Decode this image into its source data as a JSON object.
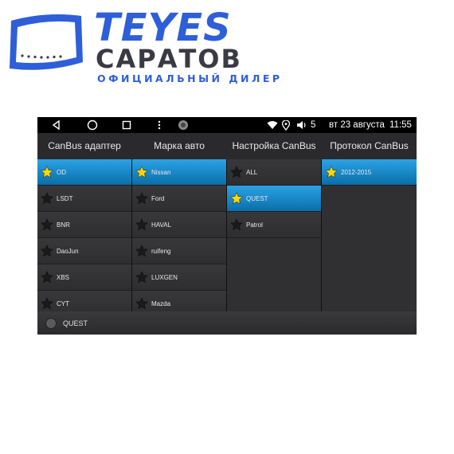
{
  "logo": {
    "brand": "TEYES",
    "city": "САРАТОВ",
    "tagline": "ОФИЦИАЛЬНЫЙ ДИЛЕР",
    "brand_color": "#2e5fd8"
  },
  "status_bar": {
    "icons": [
      "back-icon",
      "home-icon",
      "recents-icon",
      "menu-dots-icon",
      "app-icon",
      "wifi-icon",
      "location-icon",
      "volume-icon"
    ],
    "volume_level": "5",
    "date": "вт 23 августа",
    "time": "11:55"
  },
  "columns": [
    {
      "header": "CanBus адаптер",
      "selected_index": 0,
      "items": [
        "OD",
        "LSDT",
        "BNR",
        "DaoJun",
        "XBS",
        "CYT"
      ]
    },
    {
      "header": "Марка авто",
      "selected_index": 0,
      "items": [
        "Nissan",
        "Ford",
        "HAVAL",
        "ruifeng",
        "LUXGEN",
        "Mazda"
      ]
    },
    {
      "header": "Настройка CanBus",
      "selected_index": 1,
      "items": [
        "ALL",
        "QUEST",
        "Patrol"
      ]
    },
    {
      "header": "Протокол CanBus",
      "selected_index": 0,
      "items": [
        "2012-2015"
      ]
    }
  ],
  "bottom_bar": {
    "label": "QUEST"
  },
  "colors": {
    "selected_row": "#1b8fd0",
    "star_active": "#ffd60a",
    "star_inactive": "#1a1a1a"
  }
}
